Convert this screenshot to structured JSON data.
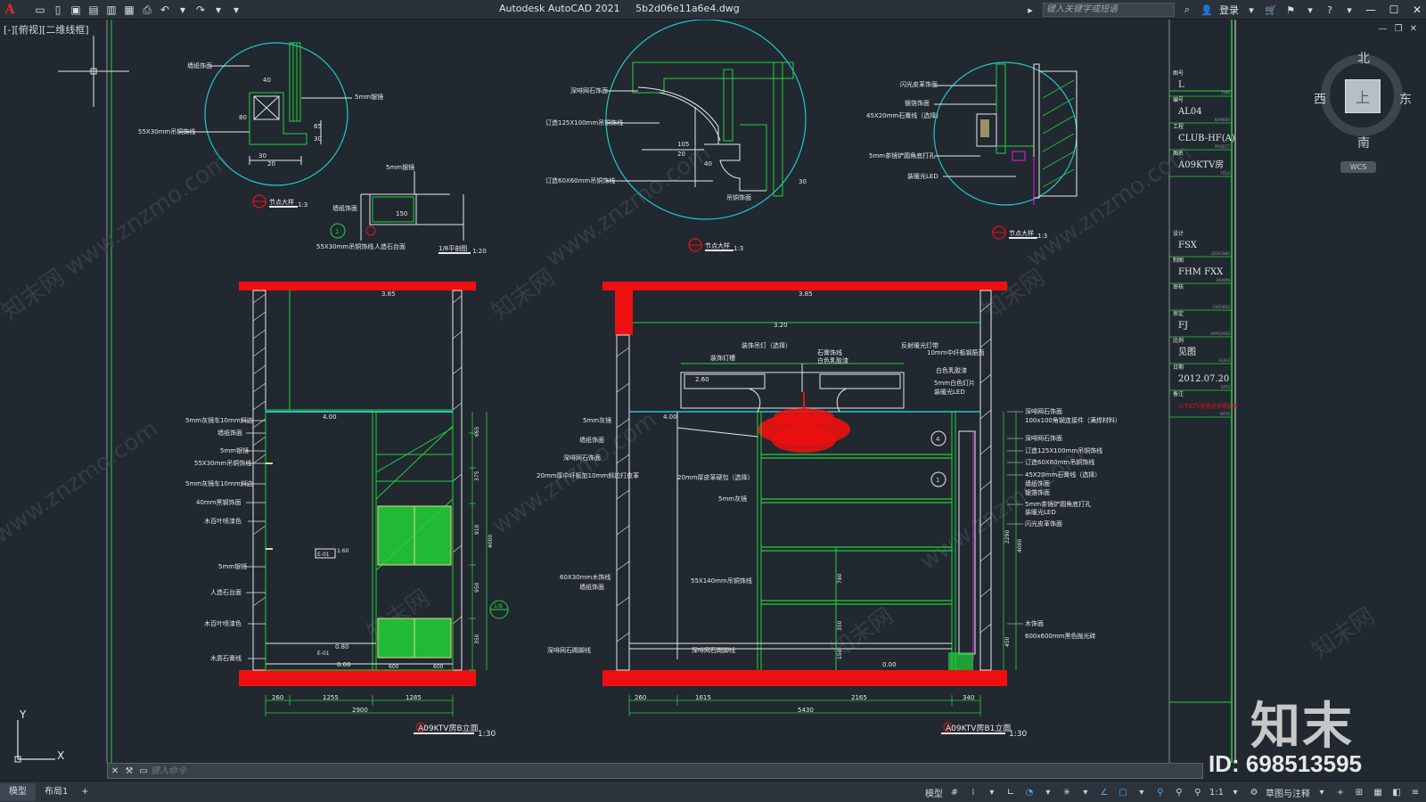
{
  "app": {
    "title": "Autodesk AutoCAD 2021",
    "file": "5b2d06e11a6e4.dwg",
    "logo": "A"
  },
  "titlebar": {
    "search_placeholder": "键入关键字或短语",
    "login_label": "登录"
  },
  "viewport": {
    "label": "[-][俯视][二维线框]"
  },
  "viewcube": {
    "top_face": "上",
    "north": "北",
    "south": "南",
    "east": "东",
    "west": "西",
    "wcs": "WCS"
  },
  "drawing": {
    "callouts": {
      "c1_caption": "节点大样",
      "c1_scale": "1:3",
      "c2_caption": "节点大样",
      "c2_scale": "1:3",
      "c3_caption": "节点大样",
      "c3_scale": "1:3",
      "section_caption": "1/8平剖图",
      "section_scale": "1:20"
    },
    "c1_labels": [
      "墙纸饰面",
      "5mm银镜",
      "55X30mm吊铜饰线",
      "40",
      "30",
      "65",
      "80",
      "20",
      "30"
    ],
    "c2_labels": [
      "深啡网石饰面",
      "订造125X100mm吊铜饰线",
      "订造60X60mm吊铜饰线",
      "吊铜饰面",
      "105",
      "20",
      "40",
      "30"
    ],
    "c3_labels": [
      "闪光皮革饰面",
      "银箔饰面",
      "45X20mm石膏线（选择）",
      "5mm茶镜铲圆角底打孔",
      "装暖光LED"
    ],
    "sec_labels": [
      "5mm银镜",
      "墙纸饰面",
      "55X30mm吊铜饰线",
      "人造石台面",
      "150"
    ],
    "elevB": {
      "title": "A09KTV房B立面",
      "scale": "1:30",
      "level_top": "3.85",
      "level_mid": "4.00",
      "level_floor": "0.00",
      "level_shelf": "0.80",
      "tag1": "E-01",
      "tag2": "E-01",
      "scale_mark": "1:60",
      "callout_ref": "1/8",
      "labels": [
        "5mm灰镜车10mm斜边",
        "墙纸饰面",
        "5mm银镜",
        "55X30mm吊铜饰线",
        "5mm灰镜车10mm斜边",
        "40mm黑钢饰面",
        "木百叶喷漆色",
        "5mm银镜",
        "人造石台面",
        "木百叶喷漆色",
        "木质石膏线"
      ],
      "dims_bottom": [
        "260",
        "1255",
        "1285"
      ],
      "dim_total": "2900",
      "dims_right": [
        "665",
        "375",
        "910",
        "950",
        "350"
      ],
      "dim_right_total": "4000",
      "dims_inner": [
        "600",
        "600"
      ]
    },
    "elevB1": {
      "title": "A09KTV房B1立面",
      "scale": "1:30",
      "level_top": "3.85",
      "level_ceiling": "3.20",
      "level_mid": "4.00",
      "level_side": "2.60",
      "level_floor": "0.00",
      "labels_left": [
        "5mm灰镜",
        "墙纸饰面",
        "深啡网石饰面",
        "20mm厚中纤板加10mm斜边打皮革",
        "60X30mm木饰线",
        "墙纸饰面",
        "深啡网石踢脚线"
      ],
      "labels_top": [
        "装饰吊灯（选择）",
        "石膏饰线",
        "装饰灯槽",
        "反射暖光灯带",
        "白色乳胶漆",
        "10mm中纤板钢筋面",
        "白色乳胶漆",
        "5mm白色灯片",
        "装暖光LED"
      ],
      "labels_center": [
        "20mm厚皮革硬包（选择）",
        "5mm灰镜",
        "55X140mm吊铜饰线",
        "深啡网石踢脚线"
      ],
      "labels_right": [
        "深啡网石饰面",
        "100x100角钢连接件（满焊材料）",
        "深啡网石饰面",
        "订造125X100mm吊铜饰线",
        "订造60X60mm吊铜饰线",
        "45X20mm石膏线（选择）",
        "墙纸饰面",
        "银箔饰面",
        "5mm茶镜铲圆角底打孔",
        "装暖光LED",
        "闪光皮革饰面",
        "木饰面",
        "600x600mm黑色抛光砖"
      ],
      "dims_bottom": [
        "260",
        "1615",
        "2165",
        "340"
      ],
      "dim_total": "5430",
      "dims_right": [
        "2290",
        "450"
      ],
      "dim_right_total": "4000",
      "dims_center": [
        "780",
        "350",
        "150"
      ]
    }
  },
  "titleblock": {
    "rows": [
      {
        "label": "图号",
        "value": "L",
        "sub": "TYPE"
      },
      {
        "label": "编号",
        "value": "AL04",
        "sub": "NUMBER"
      },
      {
        "label": "工程",
        "value": "CLUB-HF(A)",
        "sub": "PROJECT"
      },
      {
        "label": "图名",
        "value": "A09KTV房",
        "sub": "TITLE"
      },
      {
        "label": "设计",
        "value": "FSX",
        "sub": "DESIGNER"
      },
      {
        "label": "制图",
        "value": "FHM FXX",
        "sub": "DRAWN"
      },
      {
        "label": "审核",
        "value": "",
        "sub": "CHECKED"
      },
      {
        "label": "审定",
        "value": "FJ",
        "sub": "APPROVED"
      },
      {
        "label": "比例",
        "value": "见图",
        "sub": "SCALE"
      },
      {
        "label": "日期",
        "value": "2012.07.20",
        "sub": "DATE"
      },
      {
        "label": "备注",
        "value": "以下KTV房看进参照此房",
        "sub": "NOTE"
      }
    ]
  },
  "watermark": {
    "brand": "知末",
    "id": "ID: 698513595",
    "site": "www.znzmo.com",
    "site_cn": "知末网"
  },
  "commandline": {
    "placeholder": "键入命令"
  },
  "statusbar": {
    "tabs": [
      "模型",
      "布局1"
    ],
    "add_tab": "+",
    "model_label": "模型",
    "scale": "1:1",
    "workspace": "草图与注释"
  },
  "colors": {
    "background": "#212830",
    "line_green": "#22d23a",
    "line_cyan": "#22c7c7",
    "line_white": "#e8e8e8",
    "red_fill": "#ee1010",
    "magenta": "#e020e0"
  }
}
